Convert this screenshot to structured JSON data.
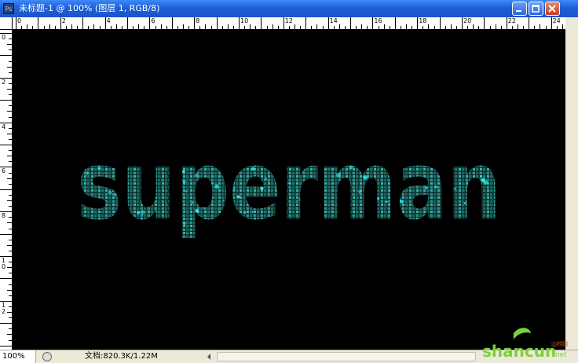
{
  "window": {
    "title": "未标题-1 @ 100% (图层 1, RGB/8)",
    "app_icon_text": "Ps"
  },
  "controls": [
    "minimize-icon",
    "maximize-icon",
    "close-icon"
  ],
  "rulers": {
    "top_labels": [
      "0",
      "2",
      "4",
      "6",
      "8",
      "10",
      "12",
      "14",
      "16",
      "18",
      "20",
      "22",
      "24"
    ],
    "left_labels": [
      "0",
      "2",
      "4",
      "6",
      "8",
      "10",
      "12"
    ]
  },
  "canvas": {
    "text": "superman",
    "colors": {
      "background": "#000000",
      "glow": "#33e6e6",
      "dim": "#1f6f6b"
    }
  },
  "status": {
    "zoom": "100%",
    "doc_info": "文档:820.3K/1.22M"
  },
  "watermark": {
    "text_main": "shancun",
    "text_suffix": ".net",
    "text_tag": "山村网"
  }
}
